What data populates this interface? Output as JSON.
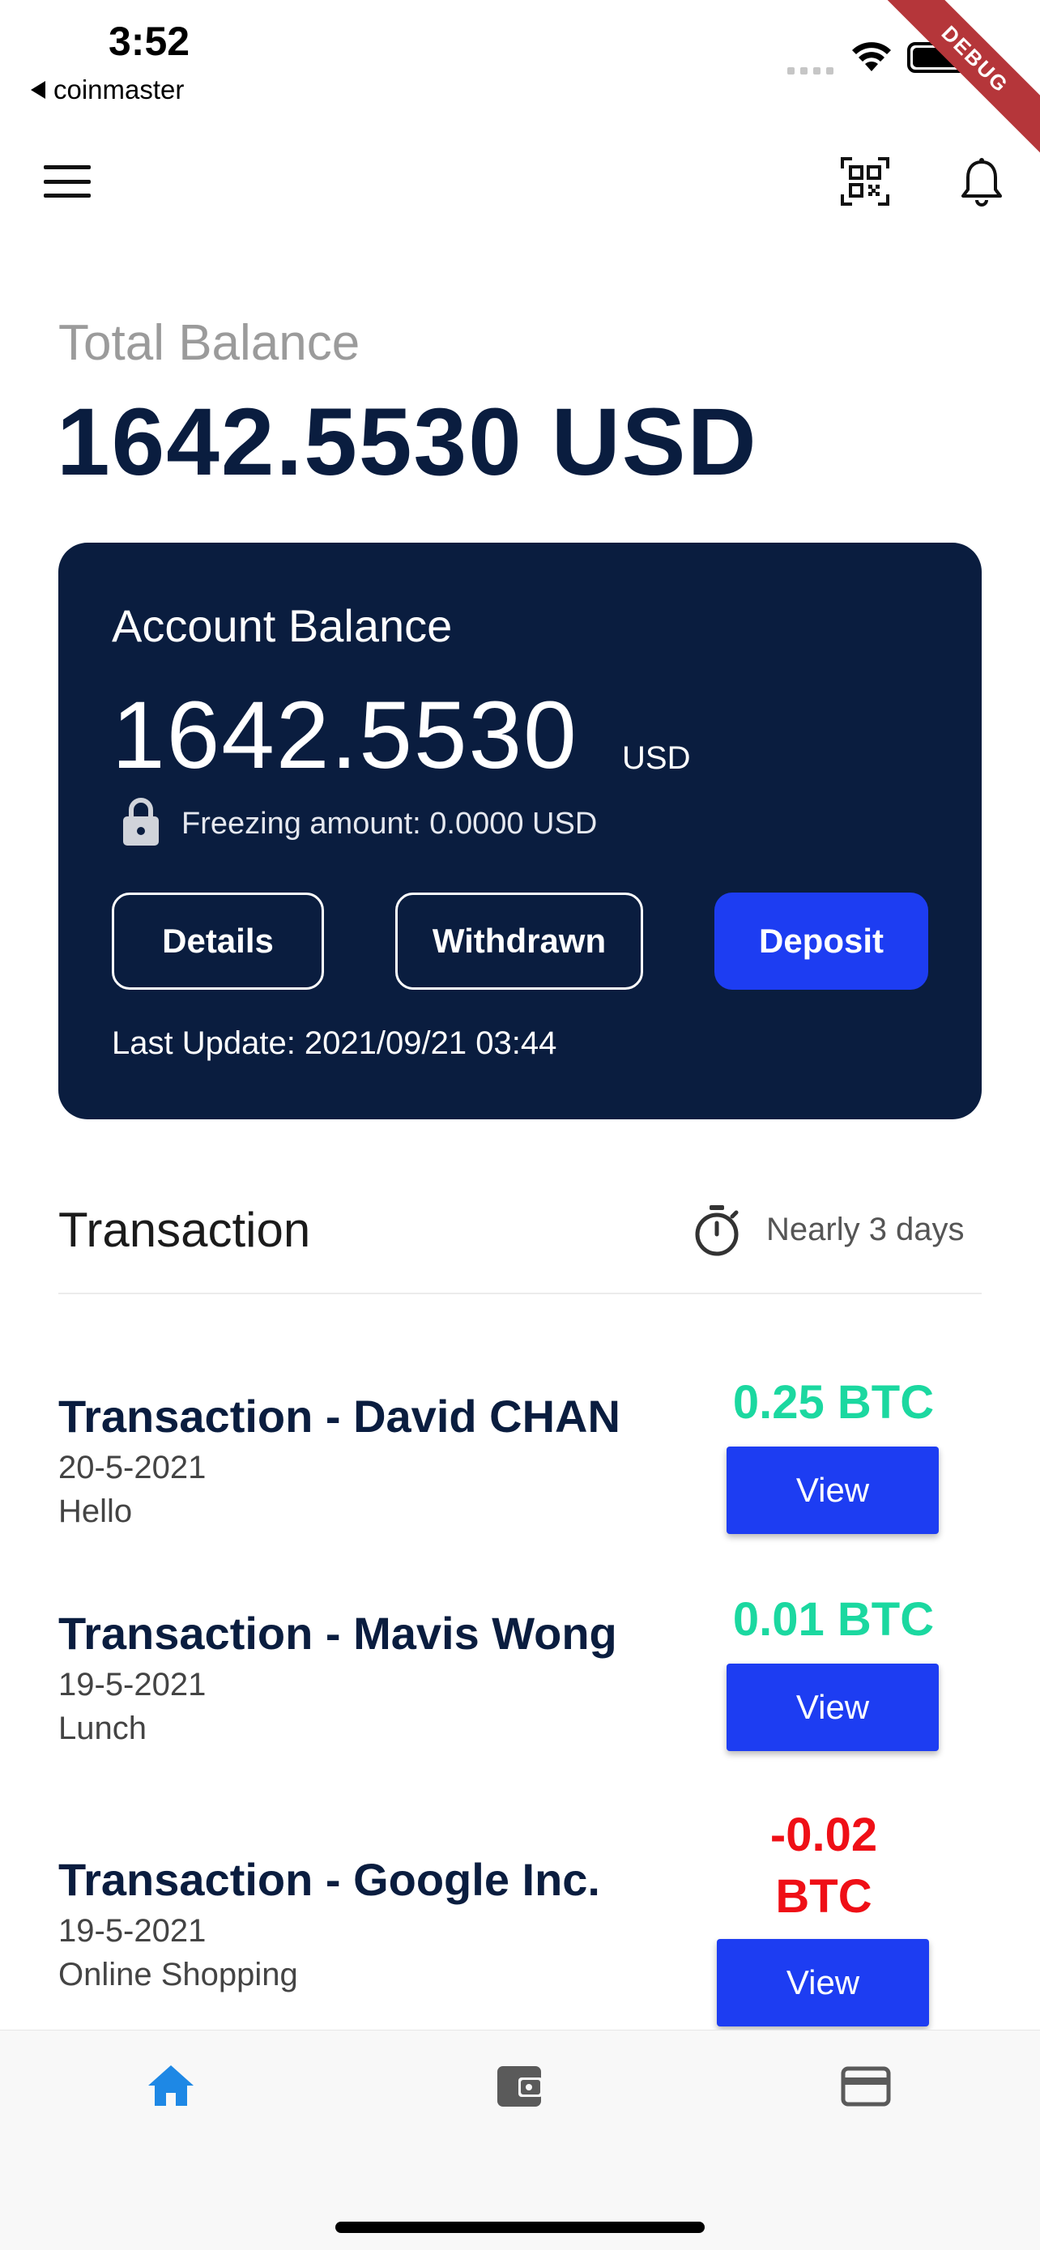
{
  "status_bar": {
    "time": "3:52",
    "back_app": "coinmaster",
    "debug_banner": "DEBUG"
  },
  "header": {
    "menu_icon": "hamburger-menu-icon",
    "qr_icon": "qr-scan-icon",
    "bell_icon": "bell-icon"
  },
  "total_balance": {
    "label": "Total Balance",
    "value": "1642.5530 USD"
  },
  "account_card": {
    "title": "Account Balance",
    "amount": "1642.5530",
    "unit": "USD",
    "freezing": "Freezing amount: 0.0000 USD",
    "buttons": {
      "details": "Details",
      "withdrawn": "Withdrawn",
      "deposit": "Deposit"
    },
    "last_update": "Last Update: 2021/09/21 03:44"
  },
  "transactions_header": {
    "title": "Transaction",
    "range": "Nearly 3 days"
  },
  "transactions": [
    {
      "name": "Transaction - David CHAN",
      "date": "20-5-2021",
      "note": "Hello",
      "amount": "0.25 BTC",
      "view": "View"
    },
    {
      "name": "Transaction - Mavis Wong",
      "date": "19-5-2021",
      "note": "Lunch",
      "amount": "0.01 BTC",
      "view": "View"
    },
    {
      "name": "Transaction - Google Inc.",
      "date": "19-5-2021",
      "note": "Online Shopping",
      "amount_line1": "-0.02",
      "amount_line2": "BTC",
      "view": "View"
    }
  ],
  "colors": {
    "navy": "#0a1d3f",
    "accent_blue": "#1d3df2",
    "positive": "#1bd8a0",
    "negative": "#ef0f16",
    "nav_active": "#1e88e5",
    "nav_inactive": "#5a5a5a"
  },
  "bottom_nav": {
    "items": [
      "home-icon",
      "wallet-icon",
      "credit-card-icon"
    ]
  }
}
